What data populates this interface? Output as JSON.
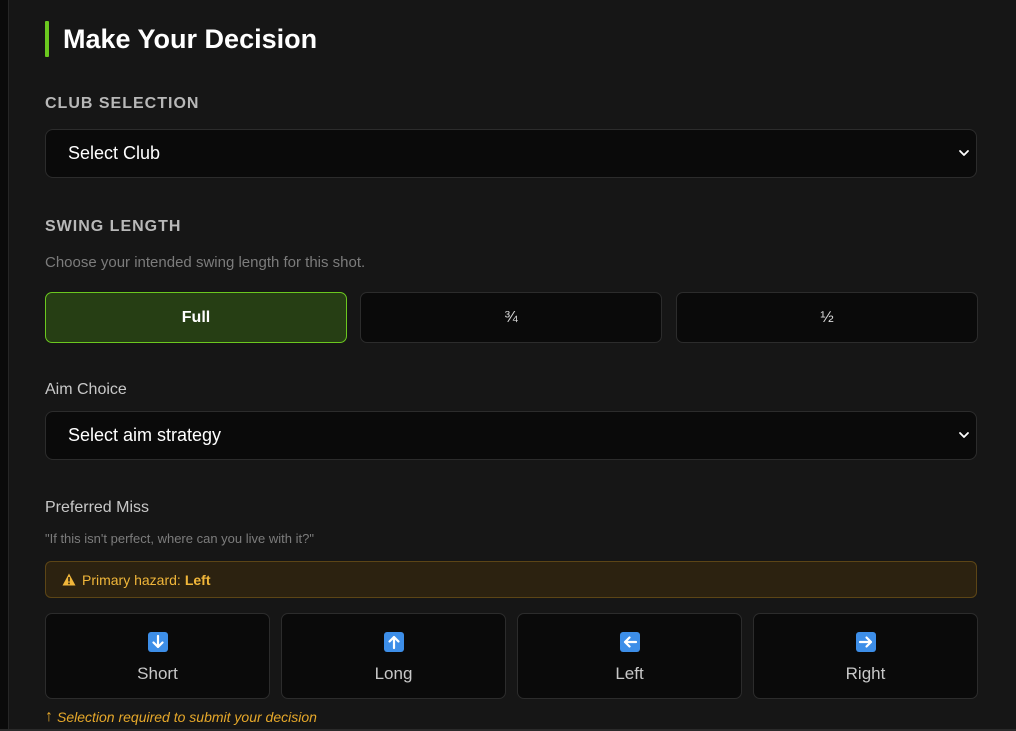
{
  "header": {
    "title": "Make Your Decision"
  },
  "club": {
    "section_label": "CLUB SELECTION",
    "select_value": "Select Club"
  },
  "swing": {
    "section_label": "SWING LENGTH",
    "hint": "Choose your intended swing length for this shot.",
    "options": [
      {
        "label": "Full",
        "selected": true
      },
      {
        "label": "¾",
        "selected": false
      },
      {
        "label": "½",
        "selected": false
      }
    ]
  },
  "aim": {
    "label": "Aim Choice",
    "select_value": "Select aim strategy"
  },
  "miss": {
    "label": "Preferred Miss",
    "hint": "\"If this isn't perfect, where can you live with it?\"",
    "hazard_prefix": "Primary hazard:",
    "hazard_value": "Left",
    "options": [
      {
        "label": "Short",
        "icon": "arrow-down-icon"
      },
      {
        "label": "Long",
        "icon": "arrow-up-icon"
      },
      {
        "label": "Left",
        "icon": "arrow-left-icon"
      },
      {
        "label": "Right",
        "icon": "arrow-right-icon"
      }
    ],
    "required_arrow": "↑",
    "required_text": "Selection required to submit your decision"
  },
  "colors": {
    "accent": "#6bc81f",
    "active_bg": "#263e14",
    "warning": "#f0b63a",
    "icon_blue": "#3d8ee8"
  }
}
